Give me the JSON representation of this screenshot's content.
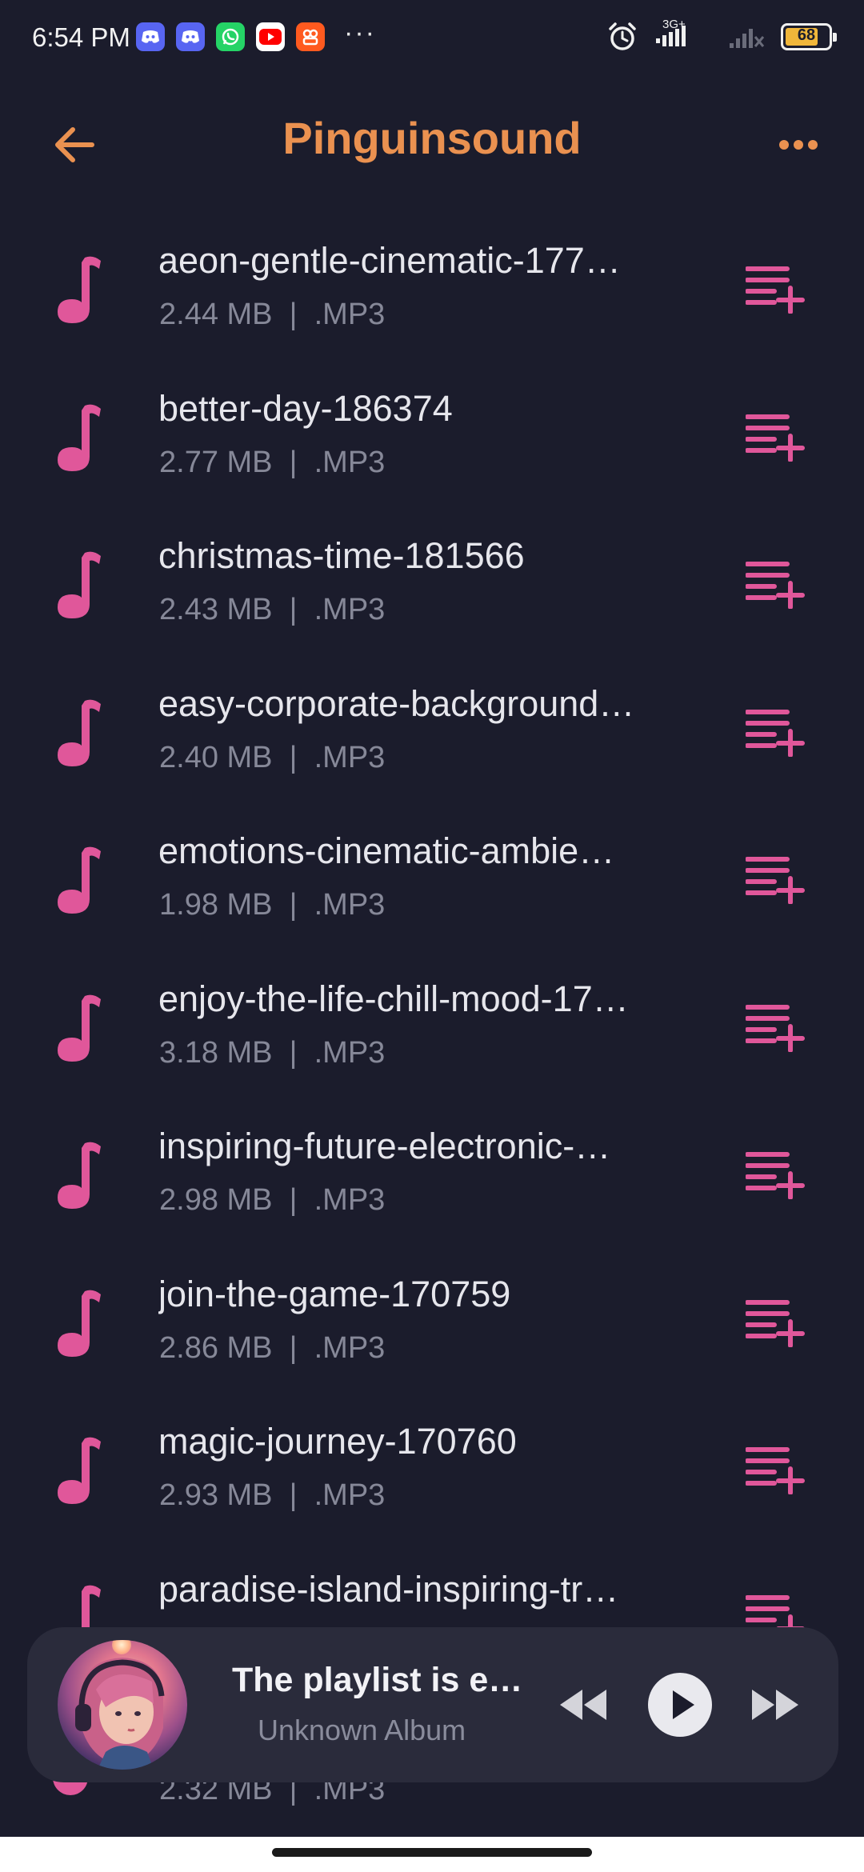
{
  "status_bar": {
    "time": "6:54 PM",
    "apps": [
      {
        "icon": "discord-icon",
        "color": "#5865f2"
      },
      {
        "icon": "discord-icon",
        "color": "#5865f2"
      },
      {
        "icon": "whatsapp-icon",
        "color": "#25d366"
      },
      {
        "icon": "youtube-icon",
        "color": "#ff0000"
      },
      {
        "icon": "app-icon",
        "color": "#ff5a1f"
      }
    ],
    "more": "···",
    "network_label": "3G+",
    "battery_level": "68"
  },
  "header": {
    "title": "Pinguinsound"
  },
  "colors": {
    "accent": "#ea9150",
    "pink": "#e0579a",
    "background": "#1b1c2c",
    "player_bg": "#2a2b3b"
  },
  "songs": [
    {
      "title": "aeon-gentle-cinematic-177…",
      "meta": "2.44 MB  |  .MP3"
    },
    {
      "title": "better-day-186374",
      "meta": "2.77 MB  |  .MP3"
    },
    {
      "title": "christmas-time-181566",
      "meta": "2.43 MB  |  .MP3"
    },
    {
      "title": "easy-corporate-background…",
      "meta": "2.40 MB  |  .MP3"
    },
    {
      "title": "emotions-cinematic-ambie…",
      "meta": "1.98 MB  |  .MP3"
    },
    {
      "title": "enjoy-the-life-chill-mood-17…",
      "meta": "3.18 MB  |  .MP3"
    },
    {
      "title": "inspiring-future-electronic-…",
      "meta": "2.98 MB  |  .MP3"
    },
    {
      "title": "join-the-game-170759",
      "meta": "2.86 MB  |  .MP3"
    },
    {
      "title": "magic-journey-170760",
      "meta": "2.93 MB  |  .MP3"
    },
    {
      "title": "paradise-island-inspiring-tr…",
      "meta": ""
    }
  ],
  "peek_meta": "2.32 MB  |  .MP3",
  "player": {
    "title": "The playlist is e…",
    "subtitle": "Unknown Album"
  }
}
